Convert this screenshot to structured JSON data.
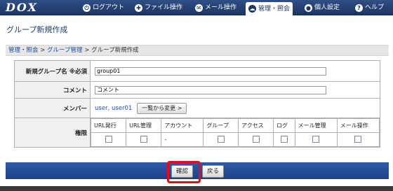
{
  "logo": "DOX",
  "nav": [
    {
      "label": "ログアウト",
      "icon": "logout-icon",
      "glyph": "⏻"
    },
    {
      "label": "ファイル操作",
      "icon": "file-ops-icon",
      "glyph": "✚"
    },
    {
      "label": "メール操作",
      "icon": "mail-icon",
      "glyph": "✉"
    },
    {
      "label": "管理・照会",
      "icon": "admin-icon",
      "glyph": "☁"
    },
    {
      "label": "個人設定",
      "icon": "personal-settings-icon",
      "glyph": "●"
    },
    {
      "label": "ヘルプ",
      "icon": "help-icon",
      "glyph": "?"
    }
  ],
  "page_title": "グループ新規作成",
  "breadcrumb": {
    "item1": "管理・照会",
    "sep": " > ",
    "item2": "グループ管理",
    "current": "グループ新規作成"
  },
  "form": {
    "group_name_label": "新規グループ名 ※必須",
    "group_name_value": "group01",
    "comment_label": "コメント",
    "comment_value": "コメント",
    "members_label": "メンバー",
    "members_value": "user, user01",
    "members_button": "一覧から変更 >",
    "permissions_label": "権限",
    "permissions": [
      {
        "label": "URL発行",
        "checkbox": true
      },
      {
        "label": "URL管理",
        "checkbox": true
      },
      {
        "label": "アカウント",
        "checkbox": false,
        "value": "-"
      },
      {
        "label": "グループ",
        "checkbox": true
      },
      {
        "label": "アクセス",
        "checkbox": true
      },
      {
        "label": "ログ",
        "checkbox": true
      },
      {
        "label": "メール管理",
        "checkbox": true
      },
      {
        "label": "メール操作",
        "checkbox": true
      }
    ]
  },
  "footer": {
    "confirm_button": "確認",
    "back_button": "戻る"
  }
}
